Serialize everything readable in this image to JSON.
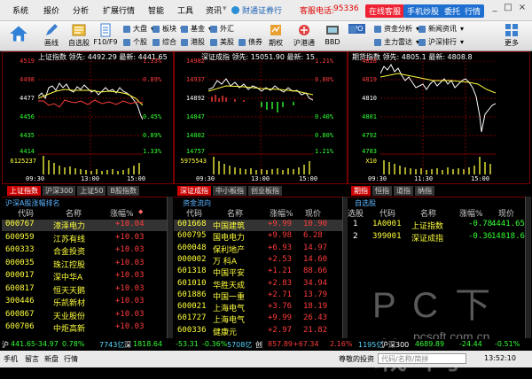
{
  "menubar": {
    "items": [
      "系统",
      "报价",
      "分析",
      "扩展行情",
      "智能",
      "工具",
      "资讯"
    ],
    "brand": "财通证券行",
    "hotline_label": "客服电话:",
    "hotline": "95336",
    "buttons": [
      "在线客服",
      "手机炒股",
      "委托",
      "行情"
    ],
    "win": [
      "_",
      "□",
      "×"
    ]
  },
  "toolbar": {
    "big": [
      "画线",
      "自选股",
      "F10/F9",
      "期权",
      "沪港通",
      "BBD",
      "更多"
    ],
    "small": [
      "大盘",
      "个股",
      "板块",
      "综合",
      "基金",
      "外汇",
      "港股",
      "美股",
      "债券",
      "资金分析",
      "主力雷达",
      "新闻资讯",
      "沪深排行",
      "IPO"
    ]
  },
  "colors": {
    "up": "#ff3b3b",
    "down": "#32ff32",
    "flat": "#ffff3c",
    "accent": "#c00000",
    "link": "#57d9ff"
  },
  "charts": [
    {
      "title": "上证指数 领先: 4492.29 最新: 4441.65",
      "vol": "6125237",
      "y": [
        "4519",
        "4498",
        "4477",
        "4456",
        "4435",
        "4414"
      ],
      "pct": [
        "1.33%",
        "0.89%",
        "0.45%",
        "0.45%",
        "0.89%",
        "1.33%"
      ],
      "x": [
        "09:30",
        "13:00",
        "15:00"
      ],
      "tabs": [
        "上证指数",
        "沪深300",
        "上证50",
        "B股指数"
      ]
    },
    {
      "title": "深证成指 领先: 15051.90 最新: 15",
      "vol": "5975543",
      "y": [
        "14982",
        "14937",
        "14892",
        "14847",
        "14802",
        "14757"
      ],
      "pct": [
        "1.21%",
        "0.80%",
        "0.40%",
        "0.40%",
        "0.80%",
        "1.21%"
      ],
      "x": [
        "09:30",
        "13:00",
        "15:00"
      ],
      "tabs": [
        "深证成指",
        "中小板指",
        "创业板指"
      ]
    },
    {
      "title": "期货指数 领先: 4805.1 最新: 4808.8",
      "vol": "X10",
      "y": [
        "4828",
        "4819",
        "4810",
        "4801",
        "4792",
        "4783"
      ],
      "pct": [
        "",
        "",
        "",
        "",
        "",
        ""
      ],
      "x": [
        "09:30",
        "11:30",
        "15:00"
      ],
      "tabs": [
        "期指",
        "恒指",
        "道指",
        "纳指"
      ]
    }
  ],
  "panel1": {
    "title": "沪深A股涨幅排名",
    "head": [
      "代码",
      "名称",
      "涨幅%"
    ],
    "rows": [
      [
        "000767",
        "漳泽电力",
        "+10.04"
      ],
      [
        "600959",
        "江苏有线",
        "+10.03"
      ],
      [
        "600333",
        "合金投资",
        "+10.03"
      ],
      [
        "000035",
        "珠江控股",
        "+10.03"
      ],
      [
        "000017",
        "深中华A",
        "+10.03"
      ],
      [
        "600817",
        "恒天天鹅",
        "+10.03"
      ],
      [
        "300446",
        "乐凯新材",
        "+10.03"
      ],
      [
        "600867",
        "天业股份",
        "+10.03"
      ],
      [
        "600706",
        "中炬高新",
        "+10.03"
      ]
    ]
  },
  "panel2": {
    "title": "资金流向",
    "head": [
      "代码",
      "名称",
      "涨幅%",
      "现价"
    ],
    "rows": [
      [
        "601668",
        "中国建筑",
        "+9.99",
        "10.90"
      ],
      [
        "600795",
        "国电电力",
        "+9.98",
        "6.28"
      ],
      [
        "600048",
        "保利地产",
        "+6.93",
        "14.97"
      ],
      [
        "000002",
        "万 科A",
        "+2.53",
        "14.60"
      ],
      [
        "601318",
        "中国平安",
        "+1.21",
        "88.66"
      ],
      [
        "601010",
        "华胜天成",
        "+2.83",
        "34.94"
      ],
      [
        "601886",
        "中国一重",
        "+2.71",
        "13.79"
      ],
      [
        "600021",
        "上海电气",
        "+3.76",
        "18.19"
      ],
      [
        "601727",
        "上海电气",
        "+9.99",
        "26.43"
      ],
      [
        "600336",
        "健康元",
        "+2.97",
        "21.82"
      ]
    ]
  },
  "panel3": {
    "title": "自选股",
    "head": [
      "选股",
      "代码",
      "名称",
      "涨幅%",
      "现价"
    ],
    "rows": [
      [
        "1",
        "1A0001",
        "上证指数",
        "-0.78",
        "4441.65"
      ],
      [
        "2",
        "399001",
        "深证成指",
        "-0.36",
        "14818.64"
      ]
    ]
  },
  "status": {
    "sh": "沪",
    "sh_val": "441.65",
    "sh_chg": "-34.97",
    "sh_pct": "0.78%",
    "sh_amt": "7743亿",
    "sz": "深",
    "sz_val": "1818.64",
    "sz_chg": "-53.31",
    "sz_pct": "-0.36%",
    "sz_amt": "5708亿",
    "cy": "创",
    "cy_val": "857.89",
    "cy_chg": "+67.34",
    "cy_pct": "2.16%",
    "hs_amt": "1195亿",
    "hs": "沪深300",
    "hs_val": "4689.89",
    "hs_chg": "-24.44",
    "hs_pct": "-0.51%"
  },
  "bottombar": {
    "items": [
      "手机",
      "留言",
      "新盘",
      "行情"
    ],
    "greeting": "尊敬的投资",
    "search_placeholder": "代码/名称/简拼",
    "clock": "13:52:10"
  },
  "watermark": {
    "main": "P C 下 载 网",
    "url": "pcsoft.com.cn"
  }
}
